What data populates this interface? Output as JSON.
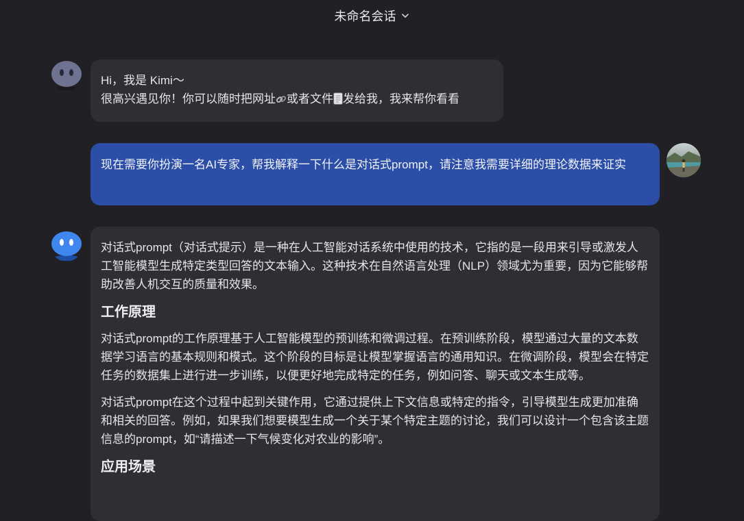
{
  "header": {
    "title": "未命名会话"
  },
  "messages": {
    "greeting": {
      "line1": "Hi，我是 Kimi～",
      "line2_a": "很高兴遇见你！你可以随时把网址",
      "line2_b": "或者文件",
      "line2_c": "发给我，我来帮你看看"
    },
    "user": {
      "text": "现在需要你扮演一名AI专家，帮我解释一下什么是对话式prompt，请注意我需要详细的理论数据来证实"
    },
    "reply": {
      "intro": "对话式prompt（对话式提示）是一种在人工智能对话系统中使用的技术，它指的是一段用来引导或激发人工智能模型生成特定类型回答的文本输入。这种技术在自然语言处理（NLP）领域尤为重要，因为它能够帮助改善人机交互的质量和效果。",
      "heading1": "工作原理",
      "para1": "对话式prompt的工作原理基于人工智能模型的预训练和微调过程。在预训练阶段，模型通过大量的文本数据学习语言的基本规则和模式。这个阶段的目标是让模型掌握语言的通用知识。在微调阶段，模型会在特定任务的数据集上进行进一步训练，以便更好地完成特定的任务，例如问答、聊天或文本生成等。",
      "para2": "对话式prompt在这个过程中起到关键作用，它通过提供上下文信息或特定的指令，引导模型生成更加准确和相关的回答。例如，如果我们想要模型生成一个关于某个特定主题的讨论，我们可以设计一个包含该主题信息的prompt，如“请描述一下气候变化对农业的影响”。",
      "heading2": "应用场景"
    }
  },
  "icons": {
    "bot_avatar": "kimi-bot-icon",
    "user_avatar": "user-photo-avatar",
    "link_emoji": "link-icon",
    "file_emoji": "file-icon",
    "chevron": "chevron-down-icon"
  },
  "colors": {
    "background": "#212125",
    "bot_bubble": "#2e2e33",
    "user_bubble": "#2c4ea6"
  }
}
